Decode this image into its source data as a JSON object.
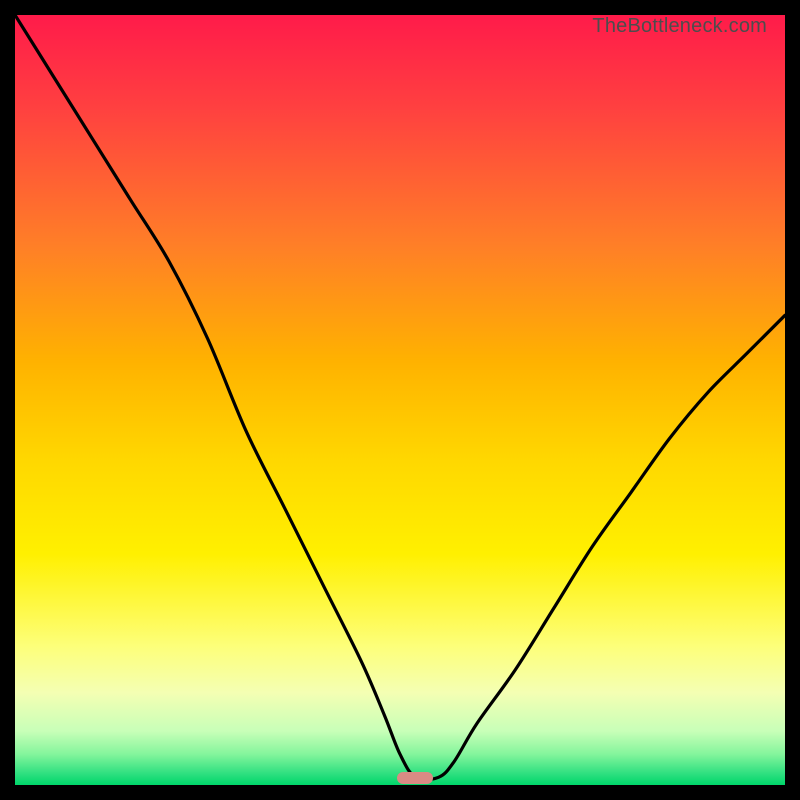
{
  "watermark": "TheBottleneck.com",
  "chart_data": {
    "type": "line",
    "title": "",
    "xlabel": "",
    "ylabel": "",
    "xlim": [
      0,
      100
    ],
    "ylim": [
      0,
      100
    ],
    "grid": false,
    "legend": false,
    "background_gradient": {
      "stops": [
        {
          "pos": 0,
          "color": "#ff1b4a"
        },
        {
          "pos": 12,
          "color": "#ff4040"
        },
        {
          "pos": 30,
          "color": "#ff7f27"
        },
        {
          "pos": 45,
          "color": "#ffb200"
        },
        {
          "pos": 58,
          "color": "#ffd800"
        },
        {
          "pos": 70,
          "color": "#fff000"
        },
        {
          "pos": 82,
          "color": "#fdff7a"
        },
        {
          "pos": 88,
          "color": "#f4ffb3"
        },
        {
          "pos": 93,
          "color": "#c8ffb8"
        },
        {
          "pos": 96,
          "color": "#84f59c"
        },
        {
          "pos": 98.5,
          "color": "#2fe080"
        },
        {
          "pos": 100,
          "color": "#00d66a"
        }
      ]
    },
    "series": [
      {
        "name": "bottleneck-curve",
        "color": "#000000",
        "x": [
          0,
          5,
          10,
          15,
          20,
          25,
          30,
          35,
          40,
          45,
          48,
          50,
          52,
          55,
          57,
          60,
          65,
          70,
          75,
          80,
          85,
          90,
          95,
          100
        ],
        "y": [
          100,
          92,
          84,
          76,
          68,
          58,
          46,
          36,
          26,
          16,
          9,
          4,
          1,
          1,
          3,
          8,
          15,
          23,
          31,
          38,
          45,
          51,
          56,
          61
        ]
      }
    ],
    "marker": {
      "name": "optimal-range",
      "x": 52,
      "y": 0,
      "color": "#d98b84"
    }
  }
}
